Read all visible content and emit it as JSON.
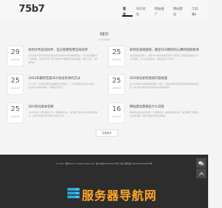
{
  "site": {
    "logo": "75b7"
  },
  "nav": {
    "items": [
      "首页",
      "SEO优化",
      "网站推广",
      "网站建设",
      "工具推▾"
    ]
  },
  "section": {
    "title": "SEO",
    "subtitle": "seo优化方法"
  },
  "posts": [
    {
      "day": "29",
      "ym": "2022-05",
      "title": "如何文件自动同步，自己搭建免费自动同步",
      "excerpt": "今天我给大家分享的是有关如何自动同步文件的相关知识，可以把它理解为一种网盘，不管你下载了哪个网盘文件都能把它放在里面，哪里下载了，都能同步。"
    },
    {
      "day": "25",
      "ym": "2022-05",
      "title": "如何生成短链接，最近SEO圈内的火爆的短链接详解",
      "excerpt": "最近短链接比较火，很多SEO站长都在研究这个短链接，短链接到底是个什么东西呢，怎么生成短链接，短链接有什么作用？"
    },
    {
      "day": "25",
      "ym": "2022-05",
      "title": "2022年最新百度SEO优化有效的方法",
      "excerpt": "2022年，不管是百度还是谷歌都已经更新了，大家也都在讨论SEO优化，最好的方法都有哪些，有哪些还有效？"
    },
    {
      "day": "25",
      "ym": "2022-05",
      "title": "SEO优化如何提高内容质量",
      "excerpt": "在SEO优化中内容是很重要的一部分，网站内容的质量直接影响到网站的排名，那么我们要如何提高网站的内容质量呢？"
    },
    {
      "day": "25",
      "ym": "2022-05",
      "title": "SEO优化基本常要",
      "excerpt": "SEO优化是一项长期的工作，想要做好SEO，首先要了解SEO优化的基本常识，这样才能更好地开展SEO优化工作。"
    },
    {
      "day": "16",
      "ym": "2022-05",
      "title": "网站建设需要些什么流程",
      "excerpt": "网站建设是企业宣传的一个重要途径，在网站建设之前，我们需要了解网站建设的流程，这样才能更好地建设网站。"
    }
  ],
  "more_button": "查看更多",
  "footer": {
    "text": "© 2021, 服务SEO All Rights Reserved. 备ICP备2021000425号 | 皖公网安备 34032402000585号"
  },
  "float_tools": {
    "icons": [
      "wechat-icon",
      "scroll-top-icon"
    ]
  },
  "watermark": {
    "text": "服务器导航网"
  },
  "colors": {
    "footer_bg": "#2d2d2d",
    "watermark": "#ffa726",
    "nav_active": "#111111"
  }
}
